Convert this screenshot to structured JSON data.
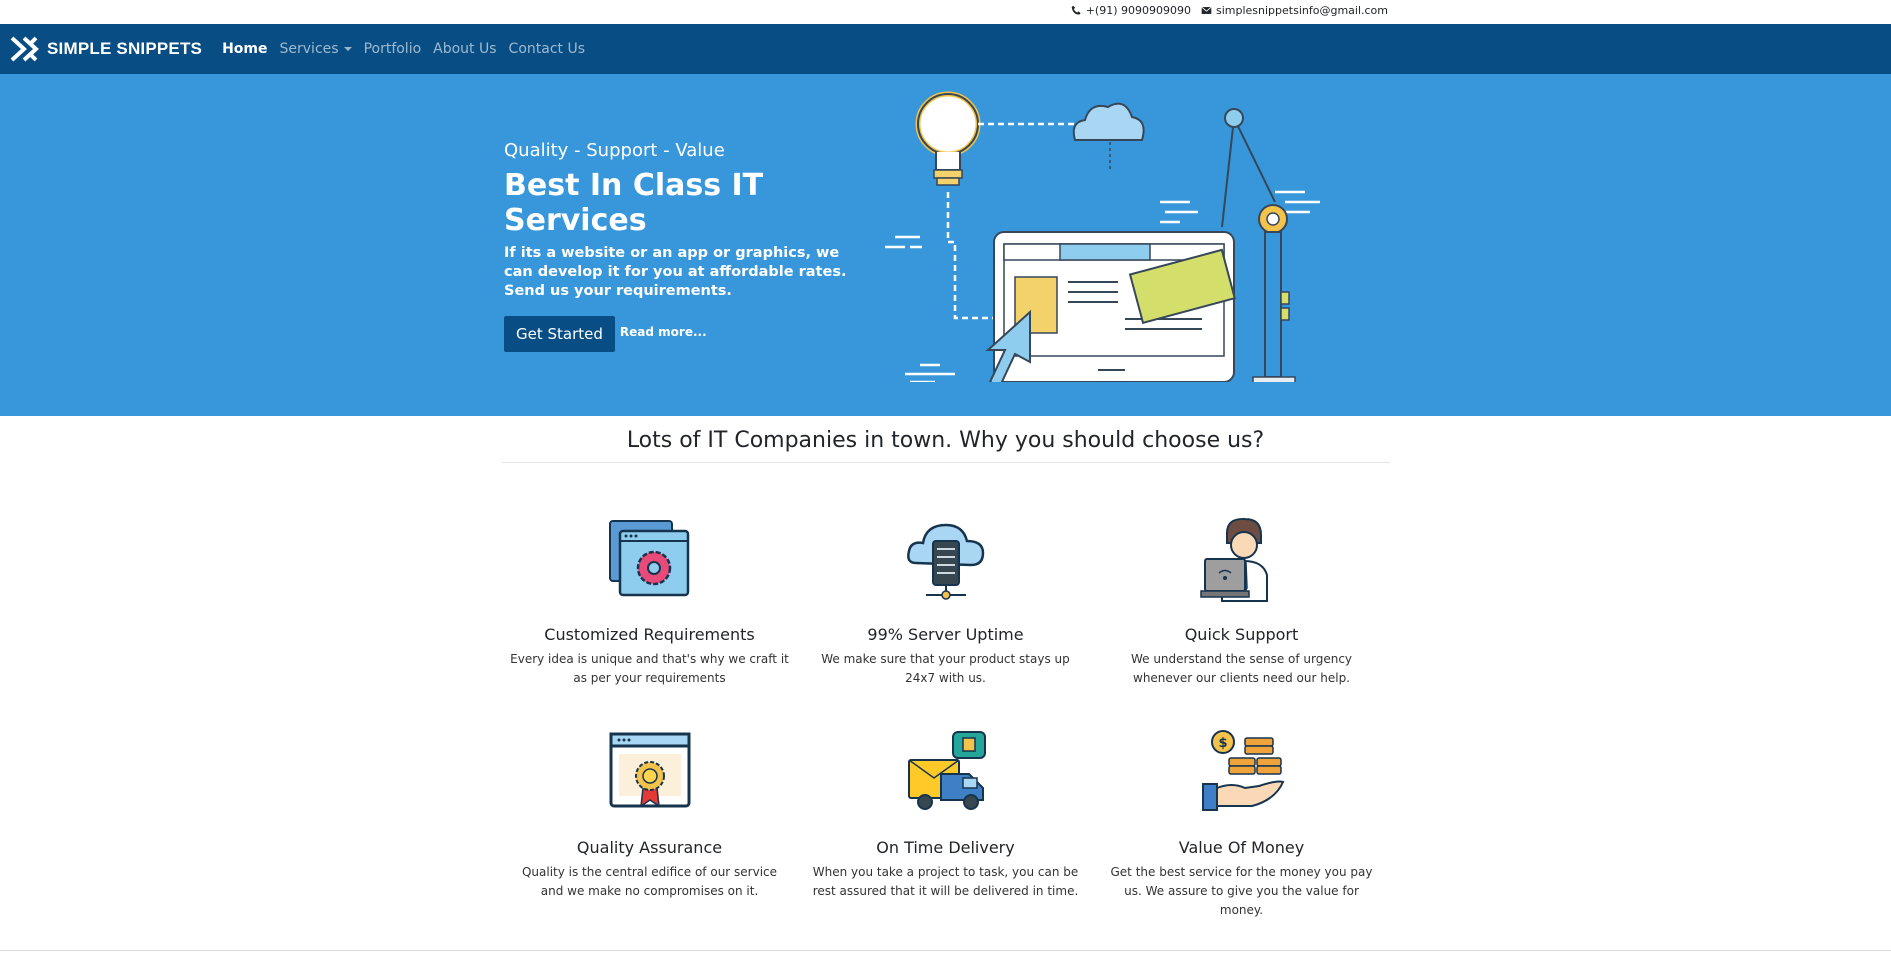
{
  "topbar": {
    "phone": "+(91) 9090909090",
    "email": "simplesnippetsinfo@gmail.com"
  },
  "brand": {
    "name": "SIMPLE SNIPPETS"
  },
  "nav": {
    "home": "Home",
    "services": "Services",
    "portfolio": "Portfolio",
    "about": "About Us",
    "contact": "Contact Us"
  },
  "hero": {
    "tagline": "Quality - Support - Value",
    "title": "Best In Class IT Services",
    "description": "If its a website or an app or graphics, we can develop it for you at affordable rates. Send us your requirements.",
    "cta": "Get Started",
    "read_more": "Read more..."
  },
  "why": {
    "title": "Lots of IT Companies in town. Why you should choose us?",
    "features": [
      {
        "title": "Customized Requirements",
        "text": "Every idea is unique and that's why we craft it as per your requirements",
        "icon": "gear-window-icon"
      },
      {
        "title": "99% Server Uptime",
        "text": "We make sure that your product stays up 24x7 with us.",
        "icon": "cloud-server-icon"
      },
      {
        "title": "Quick Support",
        "text": "We understand the sense of urgency whenever our clients need our help.",
        "icon": "support-agent-icon"
      },
      {
        "title": "Quality Assurance",
        "text": "Quality is the central edifice of our service and we make no compromises on it.",
        "icon": "certificate-icon"
      },
      {
        "title": "On Time Delivery",
        "text": "When you take a project to task, you can be rest assured that it will be delivered in time.",
        "icon": "delivery-truck-icon"
      },
      {
        "title": "Value Of Money",
        "text": "Get the best service for the money you pay us. We assure to give you the value for money.",
        "icon": "money-hand-icon"
      }
    ]
  },
  "colors": {
    "navbar": "#084e85",
    "hero": "#3897db",
    "button": "#084e85"
  }
}
